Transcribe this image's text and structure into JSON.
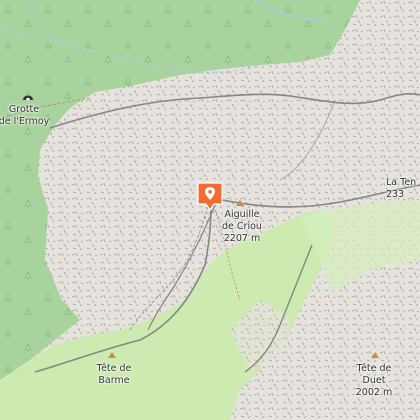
{
  "map": {
    "colors": {
      "forest": "#a9d39d",
      "meadow": "#cdebb0",
      "scree": "#e8e3de",
      "rock": "#a9a39d",
      "cliff": "#868686",
      "stream": "#a8cde6",
      "marker": "#f36b2f"
    },
    "labels": [
      {
        "id": "grotte",
        "text": "Grotte\nde l'Ermoy"
      },
      {
        "id": "aiguille",
        "text": "Aiguille\nde Criou\n2207 m"
      },
      {
        "id": "la-tenneverge",
        "text": "La Ten\n233"
      },
      {
        "id": "tete-barme",
        "text": "Tête de\nBarme"
      },
      {
        "id": "tete-duet",
        "text": "Tête de\nDuet\n2002 m"
      }
    ],
    "marker": {
      "icon": "location-pin-icon"
    },
    "peaks": [
      "aiguille",
      "tete-barme",
      "tete-duet"
    ]
  }
}
